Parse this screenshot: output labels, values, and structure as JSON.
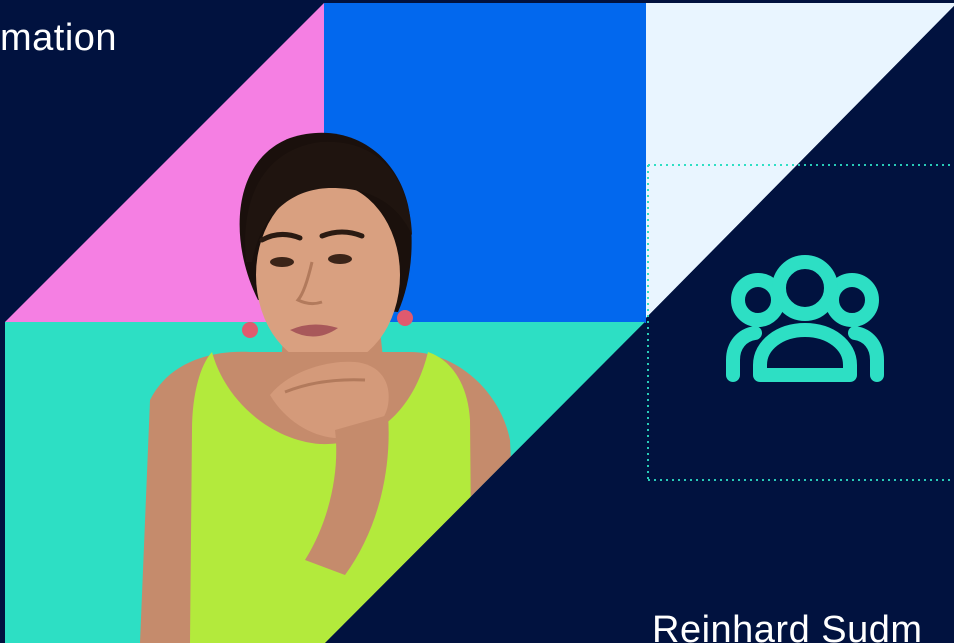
{
  "slide": {
    "title_fragment": "mation",
    "presenter_name": "Reinhard Sudm",
    "icon": "user-group-icon"
  },
  "colors": {
    "background": "#01123f",
    "pink": "#f57fe3",
    "blue": "#0268ee",
    "teal": "#2ddfc4",
    "pale": "#e9f5ff",
    "lime": "#b3ea3c",
    "icon": "#2ddfc4"
  }
}
